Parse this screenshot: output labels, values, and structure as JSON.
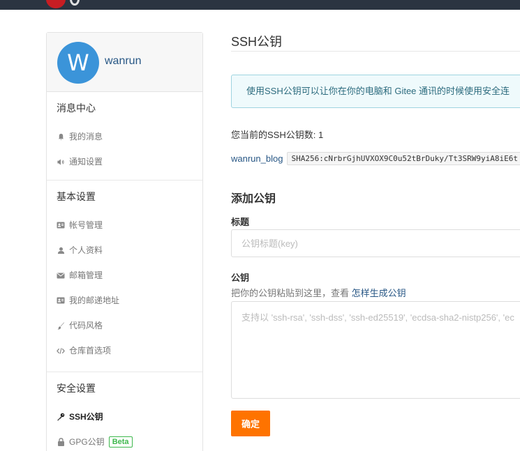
{
  "user": {
    "avatar_letter": "W",
    "name": "wanrun"
  },
  "sidebar": {
    "groups": [
      {
        "title": "消息中心",
        "items": [
          {
            "icon": "bell-icon",
            "label": "我的消息"
          },
          {
            "icon": "speaker-icon",
            "label": "通知设置"
          }
        ]
      },
      {
        "title": "基本设置",
        "items": [
          {
            "icon": "id-card-icon",
            "label": "帐号管理"
          },
          {
            "icon": "user-icon",
            "label": "个人资料"
          },
          {
            "icon": "envelope-icon",
            "label": "邮箱管理"
          },
          {
            "icon": "id-card-icon",
            "label": "我的邮递地址"
          },
          {
            "icon": "brush-icon",
            "label": "代码风格"
          },
          {
            "icon": "code-icon",
            "label": "仓库首选项"
          }
        ]
      },
      {
        "title": "安全设置",
        "items": [
          {
            "icon": "key-icon",
            "label": "SSH公钥",
            "active": true
          },
          {
            "icon": "lock-icon",
            "label": "GPG公钥",
            "badge": "Beta"
          }
        ]
      }
    ]
  },
  "main": {
    "title": "SSH公钥",
    "info": "使用SSH公钥可以让你在你的电脑和 Gitee 通讯的时候使用安全连",
    "count_text": "您当前的SSH公钥数: 1",
    "key": {
      "name": "wanrun_blog",
      "fingerprint": "SHA256:cNrbrGjhUVXOX9C0u52tBrDuky/Tt3SRW9yiA8iE6t"
    },
    "add_title": "添加公钥",
    "title_label": "标题",
    "title_placeholder": "公钥标题(key)",
    "key_label": "公钥",
    "hint_text": "把你的公钥粘贴到这里，查看",
    "hint_link": "怎样生成公钥",
    "key_placeholder": "支持以 'ssh-rsa', 'ssh-dss', 'ssh-ed25519', 'ecdsa-sha2-nistp256', 'ec",
    "submit_label": "确定"
  },
  "colors": {
    "accent": "#fe7300",
    "link": "#285785",
    "header": "#2b3441",
    "avatar": "#3b94d9",
    "badge": "#3db84c"
  }
}
